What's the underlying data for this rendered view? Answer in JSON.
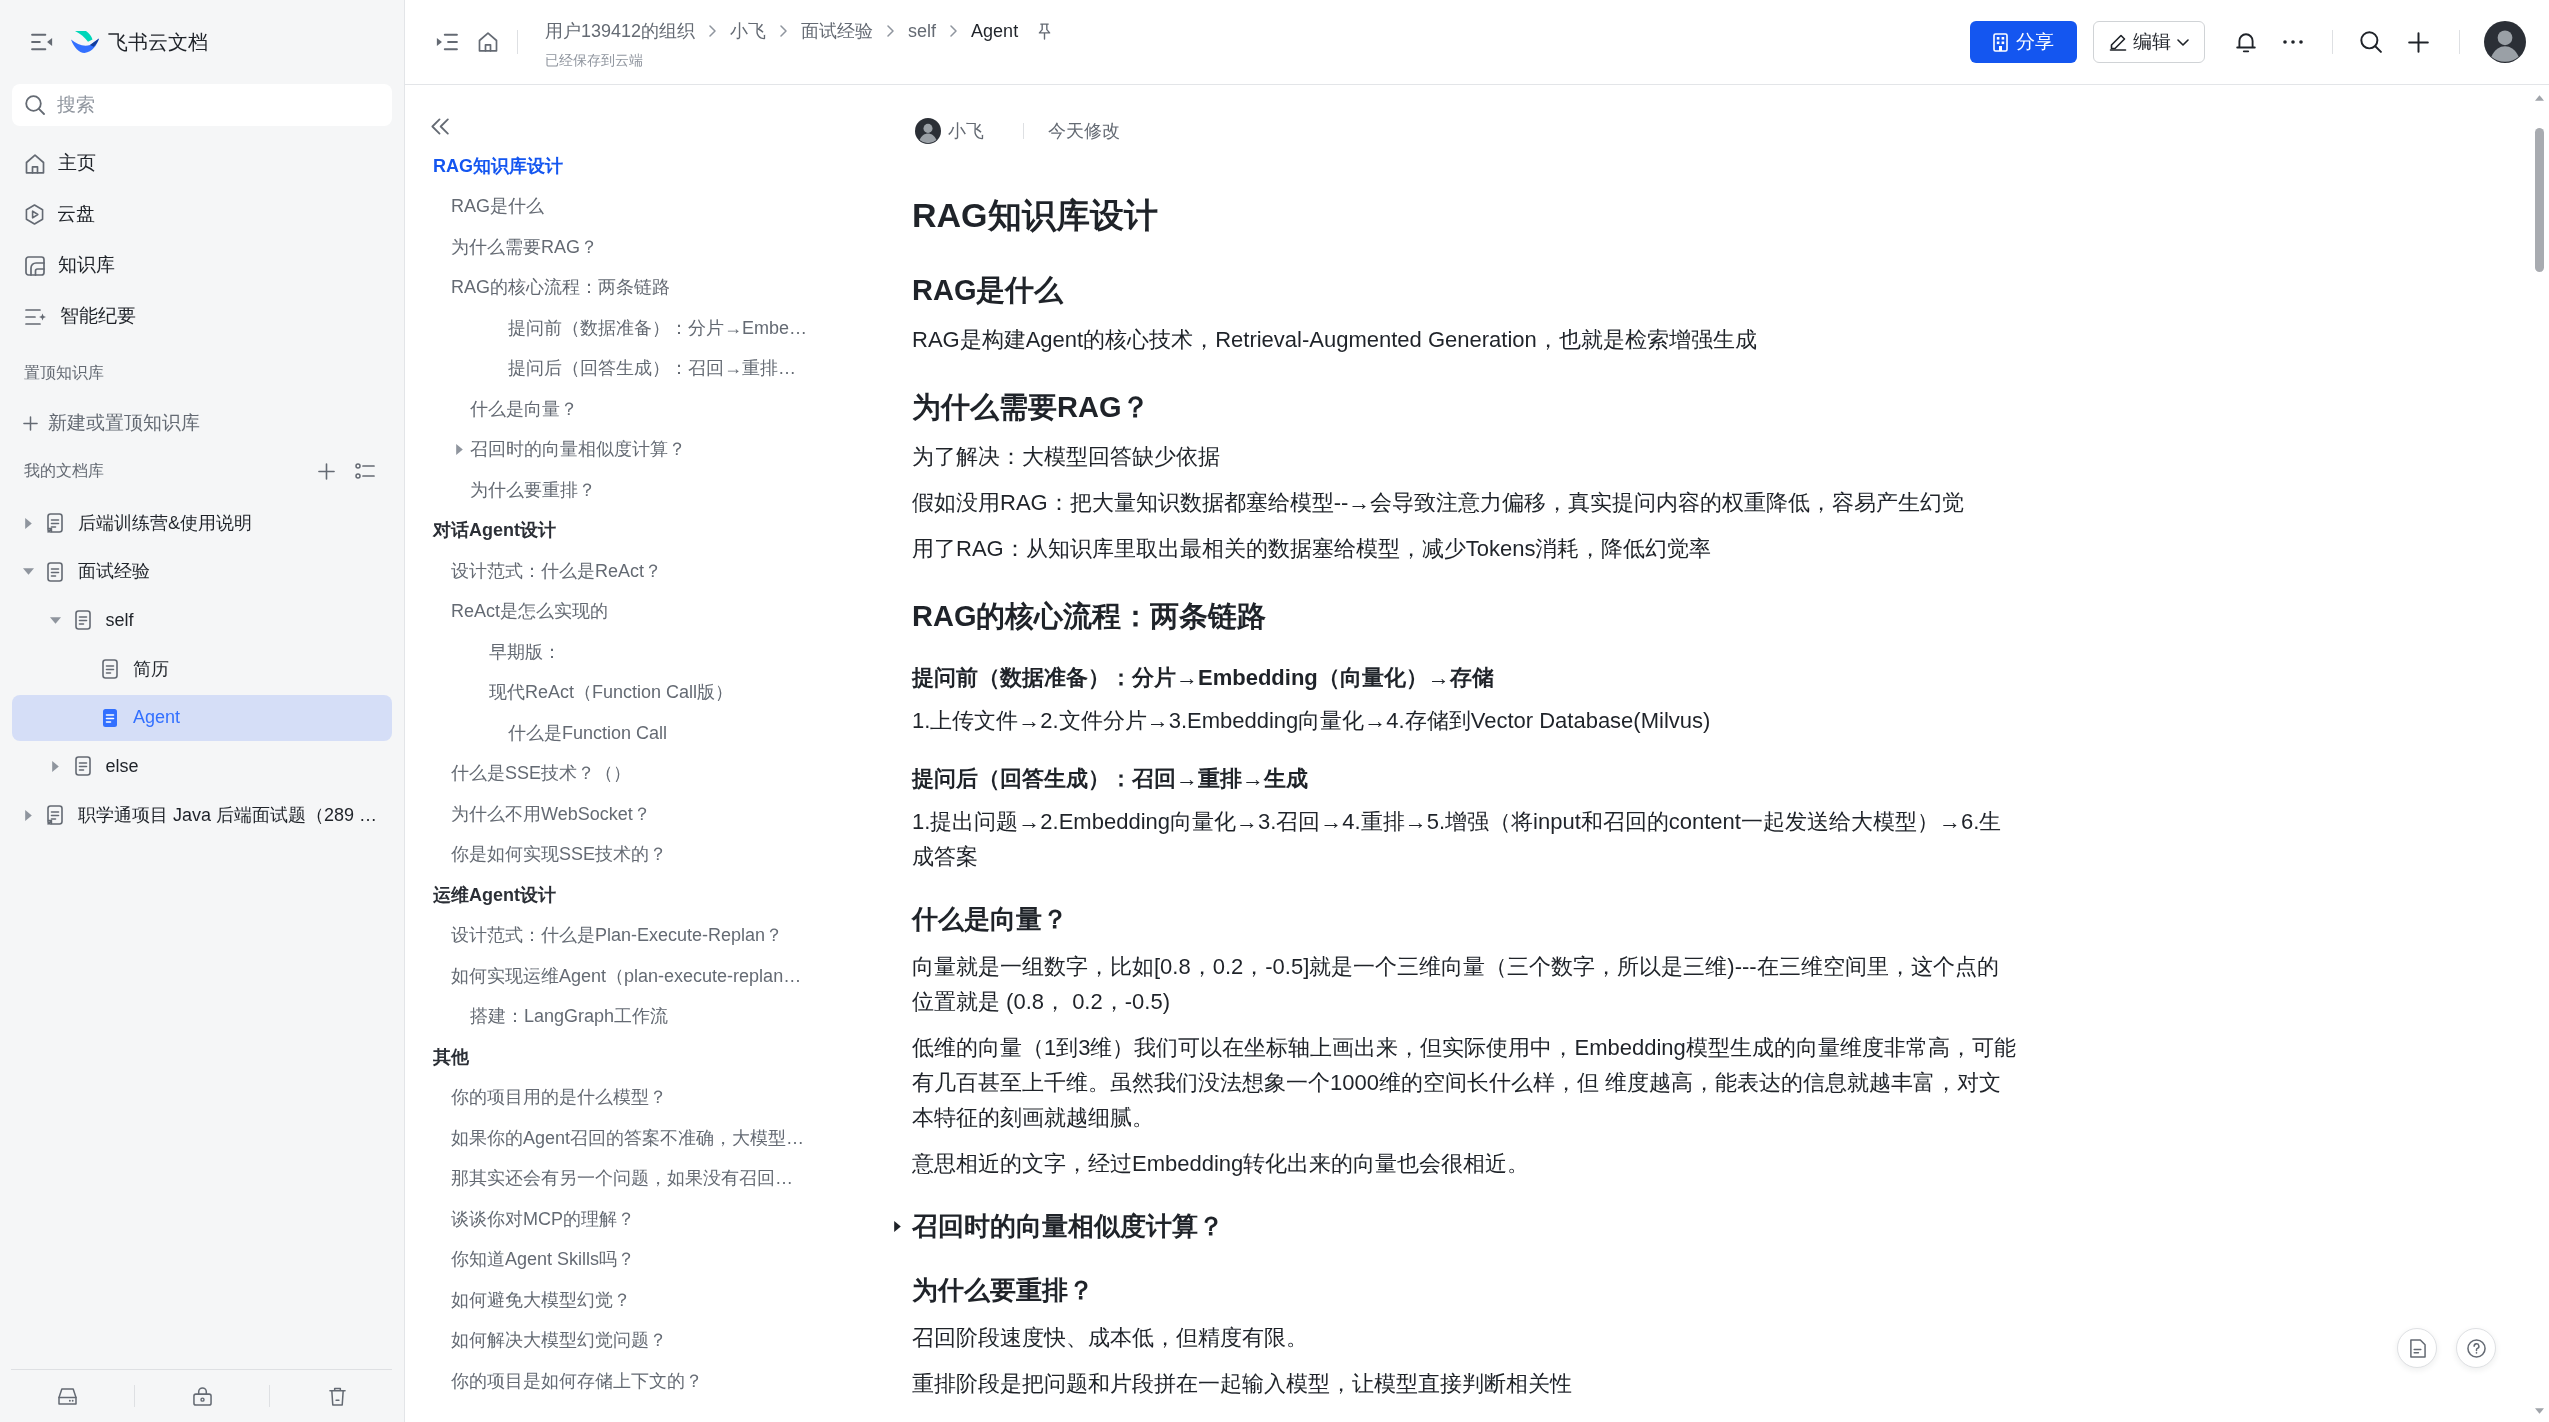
{
  "sidebar": {
    "app_name": "飞书云文档",
    "search": {
      "placeholder": "搜索"
    },
    "nav": [
      {
        "label": "主页",
        "kind": "home"
      },
      {
        "label": "云盘",
        "kind": "drive"
      },
      {
        "label": "知识库",
        "kind": "wiki"
      },
      {
        "label": "智能纪要",
        "kind": "minutes"
      }
    ],
    "pinned": {
      "title": "置顶知识库",
      "add_label": "新建或置顶知识库"
    },
    "library": {
      "title": "我的文档库"
    },
    "tree": [
      {
        "label": "后端训练营&使用说明",
        "kind": "shortcut",
        "expanded": false,
        "selected": false
      },
      {
        "label": "面试经验",
        "kind": "doc",
        "expanded": true,
        "selected": false,
        "children": [
          {
            "label": "self",
            "kind": "doc",
            "expanded": true,
            "selected": false,
            "children": [
              {
                "label": "简历",
                "kind": "doc",
                "selected": false
              },
              {
                "label": "Agent",
                "kind": "doc",
                "selected": true
              }
            ]
          },
          {
            "label": "else",
            "kind": "doc",
            "expanded": false,
            "selected": false
          }
        ]
      },
      {
        "label": "职学通项目 Java 后端面试题（289 …",
        "kind": "shortcut",
        "expanded": false,
        "selected": false
      }
    ]
  },
  "topbar": {
    "breadcrumb": [
      "用户139412的组织",
      "小飞",
      "面试经验",
      "self",
      "Agent"
    ],
    "save_status": "已经保存到云端",
    "share_label": "分享",
    "edit_label": "编辑"
  },
  "outline": [
    {
      "label": "RAG知识库设计",
      "kind": "heading1",
      "selected": true,
      "collapsed": false,
      "children": [
        {
          "label": "RAG是什么",
          "kind": "heading2",
          "selected": false,
          "collapsed": false
        },
        {
          "label": "为什么需要RAG？",
          "kind": "heading2",
          "selected": false,
          "collapsed": false
        },
        {
          "label": "RAG的核心流程：两条链路",
          "kind": "heading2",
          "selected": false,
          "collapsed": false,
          "children": [
            {
              "label": "提问前（数据准备）：分片→Embe…",
              "kind": "heading5",
              "selected": false,
              "collapsed": false
            },
            {
              "label": "提问后（回答生成）：召回→重排…",
              "kind": "heading5",
              "selected": false,
              "collapsed": false
            },
            {
              "label": "什么是向量？",
              "kind": "heading3",
              "selected": false,
              "collapsed": false
            },
            {
              "label": "召回时的向量相似度计算？",
              "kind": "heading3",
              "selected": false,
              "collapsed": true
            },
            {
              "label": "为什么要重排？",
              "kind": "heading3",
              "selected": false,
              "collapsed": false
            }
          ]
        }
      ]
    },
    {
      "label": "对话Agent设计",
      "kind": "heading1",
      "selected": false,
      "collapsed": false,
      "children": [
        {
          "label": "设计范式：什么是ReAct？",
          "kind": "heading2",
          "selected": false,
          "collapsed": false
        },
        {
          "label": "ReAct是怎么实现的",
          "kind": "heading2",
          "selected": false,
          "collapsed": false,
          "children": [
            {
              "label": "早期版：",
              "kind": "heading4",
              "selected": false,
              "collapsed": false
            },
            {
              "label": "现代ReAct（Function Call版）",
              "kind": "heading4",
              "selected": false,
              "collapsed": false,
              "children": [
                {
                  "label": "什么是Function Call",
                  "kind": "heading5",
                  "selected": false,
                  "collapsed": false
                }
              ]
            }
          ]
        },
        {
          "label": "什么是SSE技术？（）",
          "kind": "heading2",
          "selected": false,
          "collapsed": false
        },
        {
          "label": "为什么不用WebSocket？",
          "kind": "heading2",
          "selected": false,
          "collapsed": false
        },
        {
          "label": "你是如何实现SSE技术的？",
          "kind": "heading2",
          "selected": false,
          "collapsed": false
        }
      ]
    },
    {
      "label": "运维Agent设计",
      "kind": "heading1",
      "selected": false,
      "collapsed": false,
      "children": [
        {
          "label": "设计范式：什么是Plan-Execute-Replan？",
          "kind": "heading2",
          "selected": false,
          "collapsed": false
        },
        {
          "label": "如何实现运维Agent（plan-execute-replan…",
          "kind": "heading2",
          "selected": false,
          "collapsed": false,
          "children": [
            {
              "label": "搭建：LangGraph工作流",
              "kind": "heading3",
              "selected": false,
              "collapsed": false
            }
          ]
        }
      ]
    },
    {
      "label": "其他",
      "kind": "heading1",
      "selected": false,
      "collapsed": false,
      "children": [
        {
          "label": "你的项目用的是什么模型？",
          "kind": "heading2",
          "selected": false,
          "collapsed": false
        },
        {
          "label": "如果你的Agent召回的答案不准确，大模型…",
          "kind": "heading2",
          "selected": false,
          "collapsed": false
        },
        {
          "label": "那其实还会有另一个问题，如果没有召回…",
          "kind": "heading2",
          "selected": false,
          "collapsed": false
        },
        {
          "label": "谈谈你对MCP的理解？",
          "kind": "heading2",
          "selected": false,
          "collapsed": false
        },
        {
          "label": "你知道Agent Skills吗？",
          "kind": "heading2",
          "selected": false,
          "collapsed": false
        },
        {
          "label": "如何避免大模型幻觉？",
          "kind": "heading2",
          "selected": false,
          "collapsed": false
        },
        {
          "label": "如何解决大模型幻觉问题？",
          "kind": "heading2",
          "selected": false,
          "collapsed": false
        },
        {
          "label": "你的项目是如何存储上下文的？",
          "kind": "heading2",
          "selected": false,
          "collapsed": false
        }
      ]
    }
  ],
  "document": {
    "author": "小飞",
    "modified": "今天修改",
    "blocks": [
      {
        "kind": "heading1",
        "text": "RAG知识库设计",
        "collapsed": false
      },
      {
        "kind": "heading2",
        "text": "RAG是什么",
        "collapsed": false
      },
      {
        "kind": "paragraph",
        "text": "RAG是构建Agent的核心技术，Retrieval-Augmented Generation，也就是检索增强生成"
      },
      {
        "kind": "heading2",
        "text": "为什么需要RAG？",
        "collapsed": false
      },
      {
        "kind": "paragraph",
        "text": "为了解决：大模型回答缺少依据"
      },
      {
        "kind": "paragraph",
        "text": "假如没用RAG：把大量知识数据都塞给模型--→会导致注意力偏移，真实提问内容的权重降低，容易产生幻觉"
      },
      {
        "kind": "paragraph",
        "text": "用了RAG：从知识库里取出最相关的数据塞给模型，减少Tokens消耗，降低幻觉率"
      },
      {
        "kind": "heading2",
        "text": "RAG的核心流程：两条链路",
        "collapsed": false
      },
      {
        "kind": "heading5",
        "text": "提问前（数据准备）：分片→Embedding（向量化）→存储",
        "collapsed": false
      },
      {
        "kind": "paragraph",
        "text": "1.上传文件→2.文件分片→3.Embedding向量化→4.存储到Vector Database(Milvus)"
      },
      {
        "kind": "heading5",
        "text": "提问后（回答生成）：召回→重排→生成",
        "collapsed": false
      },
      {
        "kind": "paragraph",
        "text": "1.提出问题→2.Embedding向量化→3.召回→4.重排→5.增强（将input和召回的content一起发送给大模型）→6.生成答案"
      },
      {
        "kind": "heading3",
        "text": "什么是向量？",
        "collapsed": false
      },
      {
        "kind": "paragraph",
        "text": "向量就是一组数字，比如[0.8，0.2，-0.5]就是一个三维向量（三个数字，所以是三维)---在三维空间里，这个点的位置就是 (0.8， 0.2，-0.5)"
      },
      {
        "kind": "paragraph",
        "text": "低维的向量（1到3维）我们可以在坐标轴上画出来，但实际使用中，Embedding模型生成的向量维度非常高，可能有几百甚至上千维。虽然我们没法想象一个1000维的空间长什么样，但 维度越高，能表达的信息就越丰富，对文本特征的刻画就越细腻。"
      },
      {
        "kind": "paragraph",
        "text": "意思相近的文字，经过Embedding转化出来的向量也会很相近。"
      },
      {
        "kind": "heading3",
        "text": "召回时的向量相似度计算？",
        "collapsed": true
      },
      {
        "kind": "heading3",
        "text": "为什么要重排？",
        "collapsed": false
      },
      {
        "kind": "paragraph",
        "text": "召回阶段速度快、成本低，但精度有限。"
      },
      {
        "kind": "paragraph",
        "text": "重排阶段是把问题和片段拼在一起输入模型，让模型直接判断相关性"
      }
    ]
  }
}
